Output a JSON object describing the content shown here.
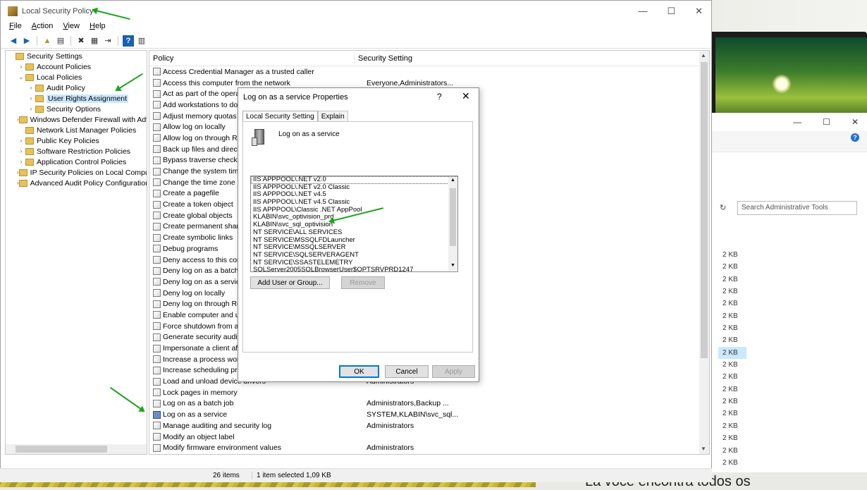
{
  "background": {
    "caption": "La voce encontra todos os"
  },
  "explorer": {
    "search_placeholder": "Search Administrative Tools",
    "sizes": [
      "2 KB",
      "2 KB",
      "2 KB",
      "2 KB",
      "2 KB",
      "2 KB",
      "2 KB",
      "2 KB",
      "2 KB",
      "2 KB",
      "2 KB",
      "2 KB",
      "2 KB",
      "2 KB",
      "2 KB",
      "2 KB",
      "2 KB",
      "2 KB"
    ],
    "selected_size_index": 8
  },
  "window": {
    "title": "Local Security Policy",
    "controls": {
      "minimize": "—",
      "maximize": "☐",
      "close": "✕"
    }
  },
  "menu": [
    "File",
    "Action",
    "View",
    "Help"
  ],
  "tree": [
    {
      "label": "Security Settings",
      "level": 0,
      "arrow": ""
    },
    {
      "label": "Account Policies",
      "level": 1,
      "arrow": "›"
    },
    {
      "label": "Local Policies",
      "level": 1,
      "arrow": "⌄"
    },
    {
      "label": "Audit Policy",
      "level": 2,
      "arrow": "›"
    },
    {
      "label": "User Rights Assignment",
      "level": 2,
      "arrow": "›",
      "selected": true
    },
    {
      "label": "Security Options",
      "level": 2,
      "arrow": "›"
    },
    {
      "label": "Windows Defender Firewall with Adva",
      "level": 1,
      "arrow": "›"
    },
    {
      "label": "Network List Manager Policies",
      "level": 1,
      "arrow": ""
    },
    {
      "label": "Public Key Policies",
      "level": 1,
      "arrow": "›"
    },
    {
      "label": "Software Restriction Policies",
      "level": 1,
      "arrow": "›"
    },
    {
      "label": "Application Control Policies",
      "level": 1,
      "arrow": "›"
    },
    {
      "label": "IP Security Policies on Local Compute",
      "level": 1,
      "arrow": "›"
    },
    {
      "label": "Advanced Audit Policy Configuration",
      "level": 1,
      "arrow": "›"
    }
  ],
  "list": {
    "headers": {
      "policy": "Policy",
      "setting": "Security Setting"
    },
    "rows": [
      {
        "policy": "Access Credential Manager as a trusted caller",
        "setting": ""
      },
      {
        "policy": "Access this computer from the network",
        "setting": "Everyone,Administrators..."
      },
      {
        "policy": "Act as part of the operati",
        "setting": ""
      },
      {
        "policy": "Add workstations to dom",
        "setting": ""
      },
      {
        "policy": "Adjust memory quotas f",
        "setting": ""
      },
      {
        "policy": "Allow log on locally",
        "setting": ""
      },
      {
        "policy": "Allow log on through Re",
        "setting": ""
      },
      {
        "policy": "Back up files and directo",
        "setting": ""
      },
      {
        "policy": "Bypass traverse checking",
        "setting": ""
      },
      {
        "policy": "Change the system time",
        "setting": ""
      },
      {
        "policy": "Change the time zone",
        "setting": ""
      },
      {
        "policy": "Create a pagefile",
        "setting": ""
      },
      {
        "policy": "Create a token object",
        "setting": ""
      },
      {
        "policy": "Create global objects",
        "setting": ""
      },
      {
        "policy": "Create permanent share",
        "setting": ""
      },
      {
        "policy": "Create symbolic links",
        "setting": ""
      },
      {
        "policy": "Debug programs",
        "setting": ""
      },
      {
        "policy": "Deny access to this com",
        "setting": ""
      },
      {
        "policy": "Deny log on as a batch jo",
        "setting": ""
      },
      {
        "policy": "Deny log on as a service",
        "setting": ""
      },
      {
        "policy": "Deny log on locally",
        "setting": ""
      },
      {
        "policy": "Deny log on through Re",
        "setting": ""
      },
      {
        "policy": "Enable computer and us",
        "setting": ""
      },
      {
        "policy": "Force shutdown from a r",
        "setting": ""
      },
      {
        "policy": "Generate security audits",
        "setting": ""
      },
      {
        "policy": "Impersonate a client afte",
        "setting": ""
      },
      {
        "policy": "Increase a process worki",
        "setting": ""
      },
      {
        "policy": "Increase scheduling prio",
        "setting": ""
      },
      {
        "policy": "Load and unload device drivers",
        "setting": "Administrators"
      },
      {
        "policy": "Lock pages in memory",
        "setting": ""
      },
      {
        "policy": "Log on as a batch job",
        "setting": "Administrators,Backup ..."
      },
      {
        "policy": "Log on as a service",
        "setting": "SYSTEM,KLABIN\\svc_sql...",
        "selected": true
      },
      {
        "policy": "Manage auditing and security log",
        "setting": "Administrators"
      },
      {
        "policy": "Modify an object label",
        "setting": ""
      },
      {
        "policy": "Modify firmware environment values",
        "setting": "Administrators"
      }
    ]
  },
  "status": {
    "items": "26 items",
    "selected": "1 item selected  1,09 KB"
  },
  "dialog": {
    "title": "Log on as a service Properties",
    "help": "?",
    "close": "✕",
    "tabs": [
      "Local Security Setting",
      "Explain"
    ],
    "policy_name": "Log on as a service",
    "accounts": [
      "IIS APPPOOL\\.NET v2.0",
      "IIS APPPOOL\\.NET v2.0 Classic",
      "IIS APPPOOL\\.NET v4.5",
      "IIS APPPOOL\\.NET v4.5 Classic",
      "IIS APPPOOL\\Classic .NET AppPool",
      "KLABIN\\svc_optivision_prd",
      "KLABIN\\svc_sql_optivision",
      "NT SERVICE\\ALL SERVICES",
      "NT SERVICE\\MSSQLFDLauncher",
      "NT SERVICE\\MSSQLSERVER",
      "NT SERVICE\\SQLSERVERAGENT",
      "NT SERVICE\\SSASTELEMETRY",
      "SQLServer2005SQLBrowserUser$OPTSRVPRD1247"
    ],
    "buttons": {
      "add": "Add User or Group...",
      "remove": "Remove",
      "ok": "OK",
      "cancel": "Cancel",
      "apply": "Apply"
    }
  }
}
